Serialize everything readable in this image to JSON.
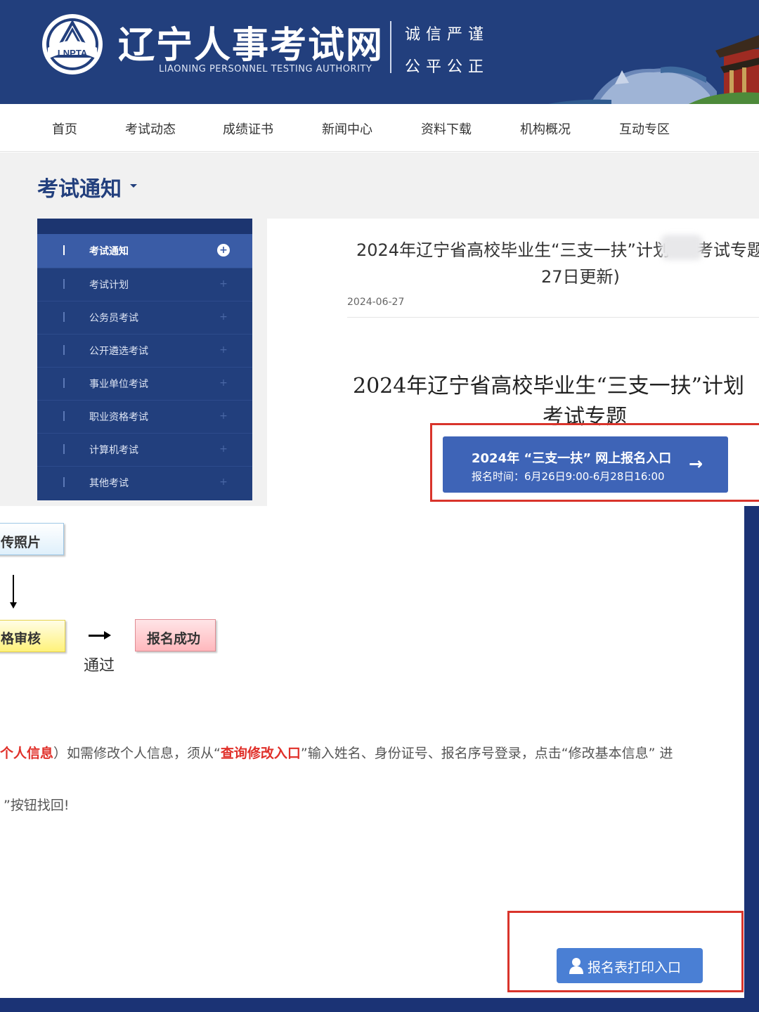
{
  "header": {
    "title": "辽宁人事考试网",
    "subtitle": "LIAONING PERSONNEL TESTING AUTHORITY",
    "logo_text": "LNPTA",
    "slogan_line1": "诚信严谨",
    "slogan_line2": "公平公正",
    "bg_color": "#223f7d"
  },
  "nav": {
    "items": [
      "首页",
      "考试动态",
      "成绩证书",
      "新闻中心",
      "资料下载",
      "机构概况",
      "互动专区"
    ]
  },
  "section": {
    "title": "考试通知"
  },
  "sidebar": {
    "items": [
      {
        "label": "考试通知",
        "active": true
      },
      {
        "label": "考试计划",
        "active": false
      },
      {
        "label": "公务员考试",
        "active": false
      },
      {
        "label": "公开遴选考试",
        "active": false
      },
      {
        "label": "事业单位考试",
        "active": false
      },
      {
        "label": "职业资格考试",
        "active": false
      },
      {
        "label": "计算机考试",
        "active": false
      },
      {
        "label": "其他考试",
        "active": false
      }
    ],
    "plus_icon": "+"
  },
  "article": {
    "title_line1": "2024年辽宁省高校毕业生“三支一扶”计划",
    "title_line1_end": "考试专题",
    "title_line2": "27日更新)",
    "date": "2024-06-27",
    "heading_line1": "2024年辽宁省高校毕业生“三支一扶”计划",
    "heading_line2": "考试专题"
  },
  "register_button": {
    "line1": "2024年 “三支一扶” 网上报名入口",
    "line2": "报名时间：6月26日9:00-6月28日16:00",
    "arrow": "→"
  },
  "flow": {
    "step1": "传照片",
    "step2": "格审核",
    "step3": "报名成功",
    "pass_label": "通过"
  },
  "notes": {
    "line1_red1": "个人信息",
    "line1_a": "）如需修改个人信息，须从“",
    "line1_red2": "查询修改入口",
    "line1_b": "”输入姓名、身份证号、报名序号登录，点击“修改基本信息” 进",
    "line2": "”按钮找回!"
  },
  "print_button": {
    "label": "报名表打印入口"
  },
  "colors": {
    "accent_red": "#d9342b",
    "button_blue": "#3e64b7",
    "print_blue": "#4a7fd4",
    "sidebar_active": "#3a5ca6"
  }
}
